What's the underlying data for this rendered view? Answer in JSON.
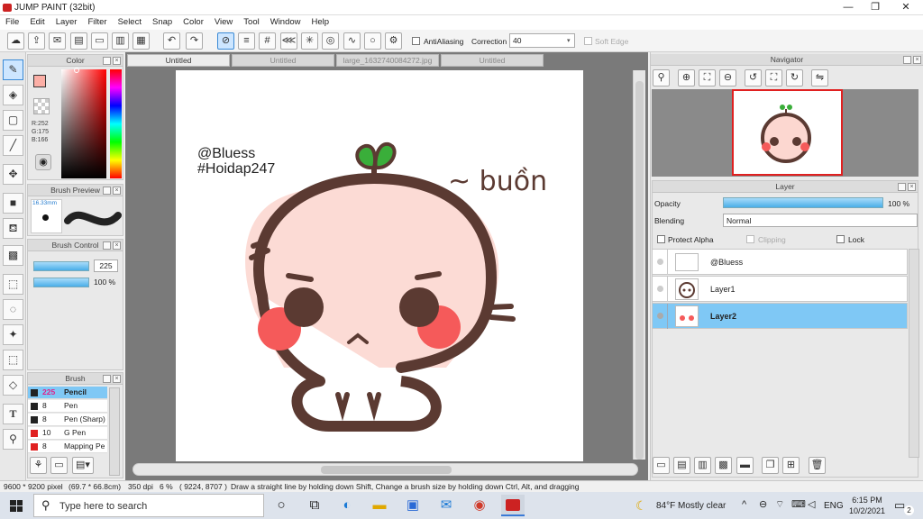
{
  "window": {
    "title": "JUMP PAINT (32bit)",
    "min": "—",
    "max": "❐",
    "close": "✕"
  },
  "menu": [
    "File",
    "Edit",
    "Layer",
    "Filter",
    "Select",
    "Snap",
    "Color",
    "View",
    "Tool",
    "Window",
    "Help"
  ],
  "toolbar": {
    "antialias_label": "AntiAliasing",
    "correction_label": "Correction",
    "correction_value": "40",
    "softedge_label": "Soft Edge"
  },
  "tabs": [
    "Untitled",
    "Untitled",
    "large_1632740084272.jpg",
    "Untitled"
  ],
  "color_panel": {
    "title": "Color",
    "r": "R:252",
    "g": "G:175",
    "b": "B:166",
    "fg": "#fcafa6",
    "bg": "#2a2a2a"
  },
  "brush_preview": {
    "title": "Brush Preview",
    "size": "16.33mm"
  },
  "brush_control": {
    "title": "Brush Control",
    "size": "225",
    "opacity": "100 %"
  },
  "brush_panel": {
    "title": "Brush",
    "items": [
      {
        "size": "225",
        "name": "Pencil",
        "color": "#222222"
      },
      {
        "size": "8",
        "name": "Pen",
        "color": "#222222"
      },
      {
        "size": "8",
        "name": "Pen (Sharp)",
        "color": "#222222"
      },
      {
        "size": "10",
        "name": "G Pen",
        "color": "#e02020"
      },
      {
        "size": "8",
        "name": "Mapping Pe",
        "color": "#e02020"
      }
    ]
  },
  "artwork": {
    "line1": "@Bluess",
    "line2": "#Hoidap247",
    "caption": "~ buồn"
  },
  "navigator": {
    "title": "Navigator"
  },
  "layer_panel": {
    "title": "Layer",
    "opacity_label": "Opacity",
    "opacity_value": "100 %",
    "blending_label": "Blending",
    "blending_value": "Normal",
    "protect_alpha": "Protect Alpha",
    "clipping": "Clipping",
    "lock": "Lock",
    "layers": [
      {
        "name": "@Bluess",
        "selected": false
      },
      {
        "name": "Layer1",
        "selected": false
      },
      {
        "name": "Layer2",
        "selected": true
      }
    ]
  },
  "status": {
    "size": "9600 * 9200 pixel",
    "mm": "(69.7 * 66.8cm)",
    "dpi": "350 dpi",
    "zoom": "6 %",
    "coords": "( 9224, 8707 )",
    "hint": "Draw a straight line by holding down Shift, Change a brush size by holding down Ctrl, Alt, and dragging"
  },
  "taskbar": {
    "search": "Type here to search",
    "weather": "84°F  Mostly clear",
    "lang": "ENG",
    "time": "6:15 PM",
    "date": "10/2/2021",
    "notif": "2"
  }
}
